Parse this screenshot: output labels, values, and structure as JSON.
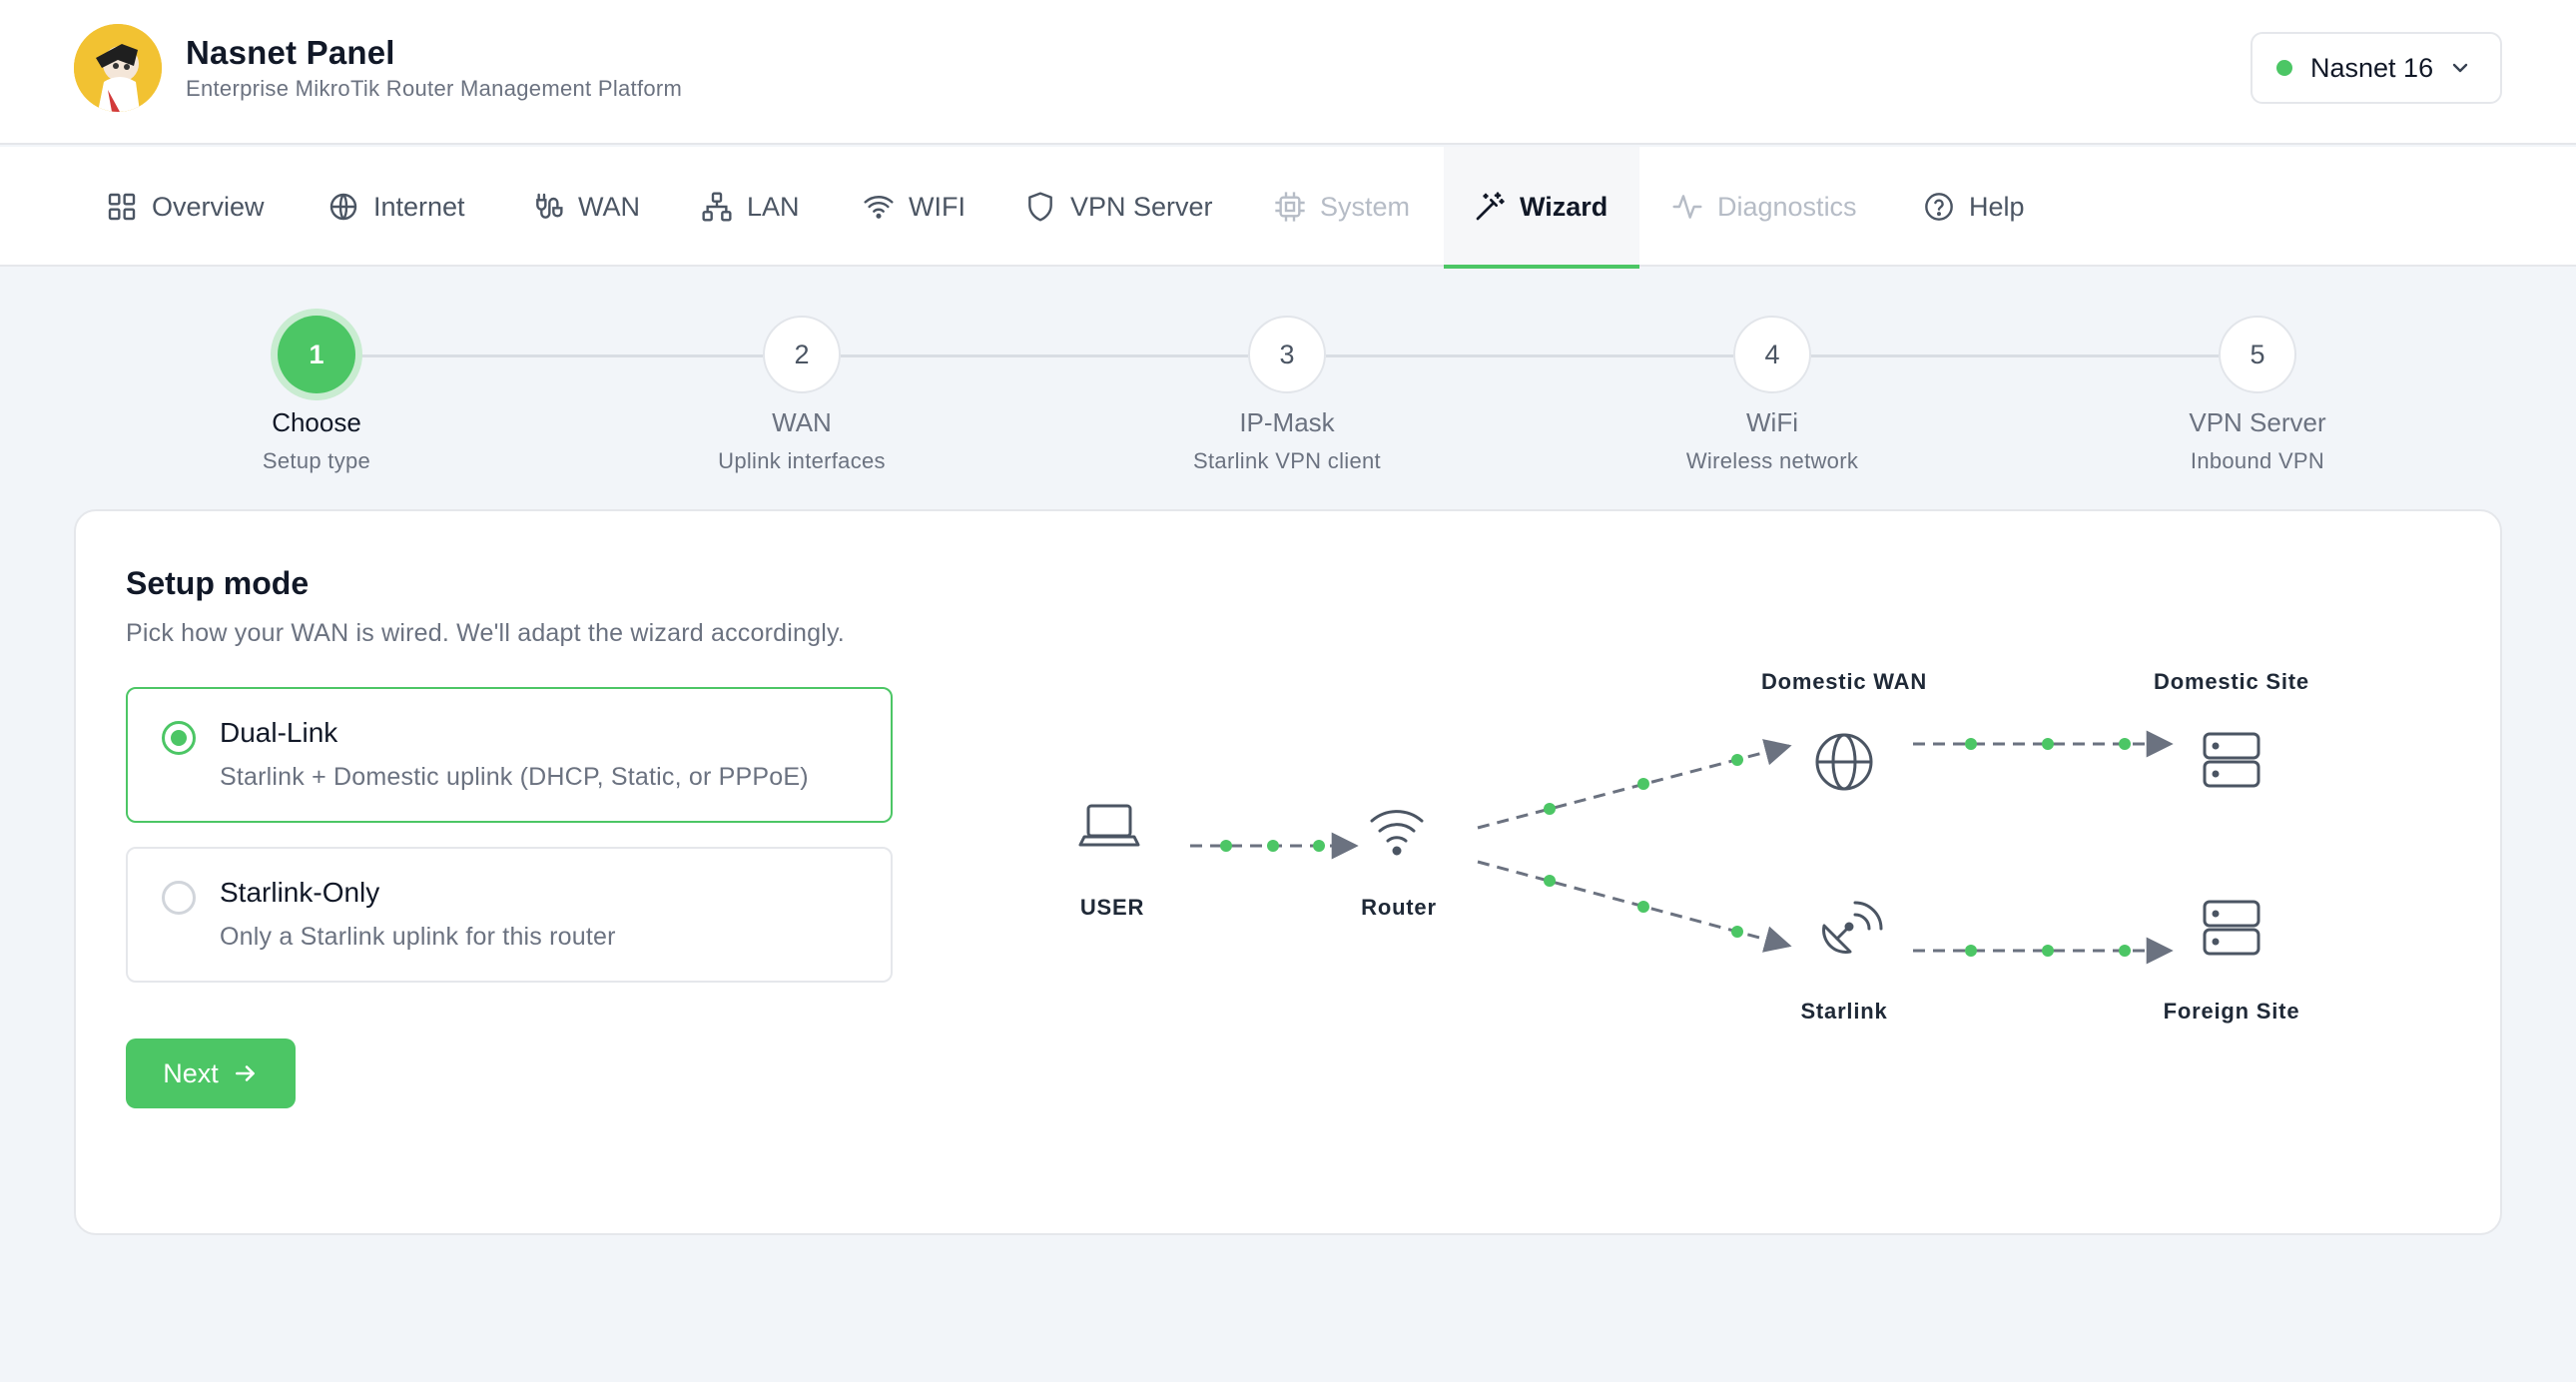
{
  "header": {
    "title": "Nasnet Panel",
    "subtitle": "Enterprise MikroTik Router Management Platform",
    "router_select": {
      "label": "Nasnet 16",
      "status_color": "#4cc665"
    }
  },
  "nav": {
    "items": [
      {
        "label": "Overview",
        "icon": "grid-icon",
        "state": "normal"
      },
      {
        "label": "Internet",
        "icon": "globe-icon",
        "state": "normal"
      },
      {
        "label": "WAN",
        "icon": "cable-icon",
        "state": "normal"
      },
      {
        "label": "LAN",
        "icon": "network-icon",
        "state": "normal"
      },
      {
        "label": "WIFI",
        "icon": "wifi-icon",
        "state": "normal"
      },
      {
        "label": "VPN Server",
        "icon": "shield-icon",
        "state": "normal"
      },
      {
        "label": "System",
        "icon": "cpu-icon",
        "state": "disabled"
      },
      {
        "label": "Wizard",
        "icon": "magic-wand-icon",
        "state": "active"
      },
      {
        "label": "Diagnostics",
        "icon": "activity-icon",
        "state": "disabled"
      },
      {
        "label": "Help",
        "icon": "help-circle-icon",
        "state": "normal"
      }
    ]
  },
  "stepper": {
    "current": 1,
    "steps": [
      {
        "number": "1",
        "title": "Choose",
        "subtitle": "Setup type"
      },
      {
        "number": "2",
        "title": "WAN",
        "subtitle": "Uplink interfaces"
      },
      {
        "number": "3",
        "title": "IP-Mask",
        "subtitle": "Starlink VPN client"
      },
      {
        "number": "4",
        "title": "WiFi",
        "subtitle": "Wireless network"
      },
      {
        "number": "5",
        "title": "VPN Server",
        "subtitle": "Inbound VPN"
      }
    ]
  },
  "setup": {
    "title": "Setup mode",
    "subtitle": "Pick how your WAN is wired. We'll adapt the wizard accordingly.",
    "options": [
      {
        "title": "Dual-Link",
        "description": "Starlink + Domestic uplink (DHCP, Static, or PPPoE)",
        "selected": true
      },
      {
        "title": "Starlink-Only",
        "description": "Only a Starlink uplink for this router",
        "selected": false
      }
    ],
    "next_label": "Next"
  },
  "diagram": {
    "nodes": {
      "user": "USER",
      "router": "Router",
      "domestic_wan": "Domestic WAN",
      "starlink": "Starlink",
      "domestic_site": "Domestic Site",
      "foreign_site": "Foreign Site"
    },
    "flow_color": "#4cc665",
    "line_color": "#6b7280"
  },
  "colors": {
    "accent": "#4cc665",
    "accent_soft": "#c9ecd1",
    "background": "#f2f5f9"
  }
}
